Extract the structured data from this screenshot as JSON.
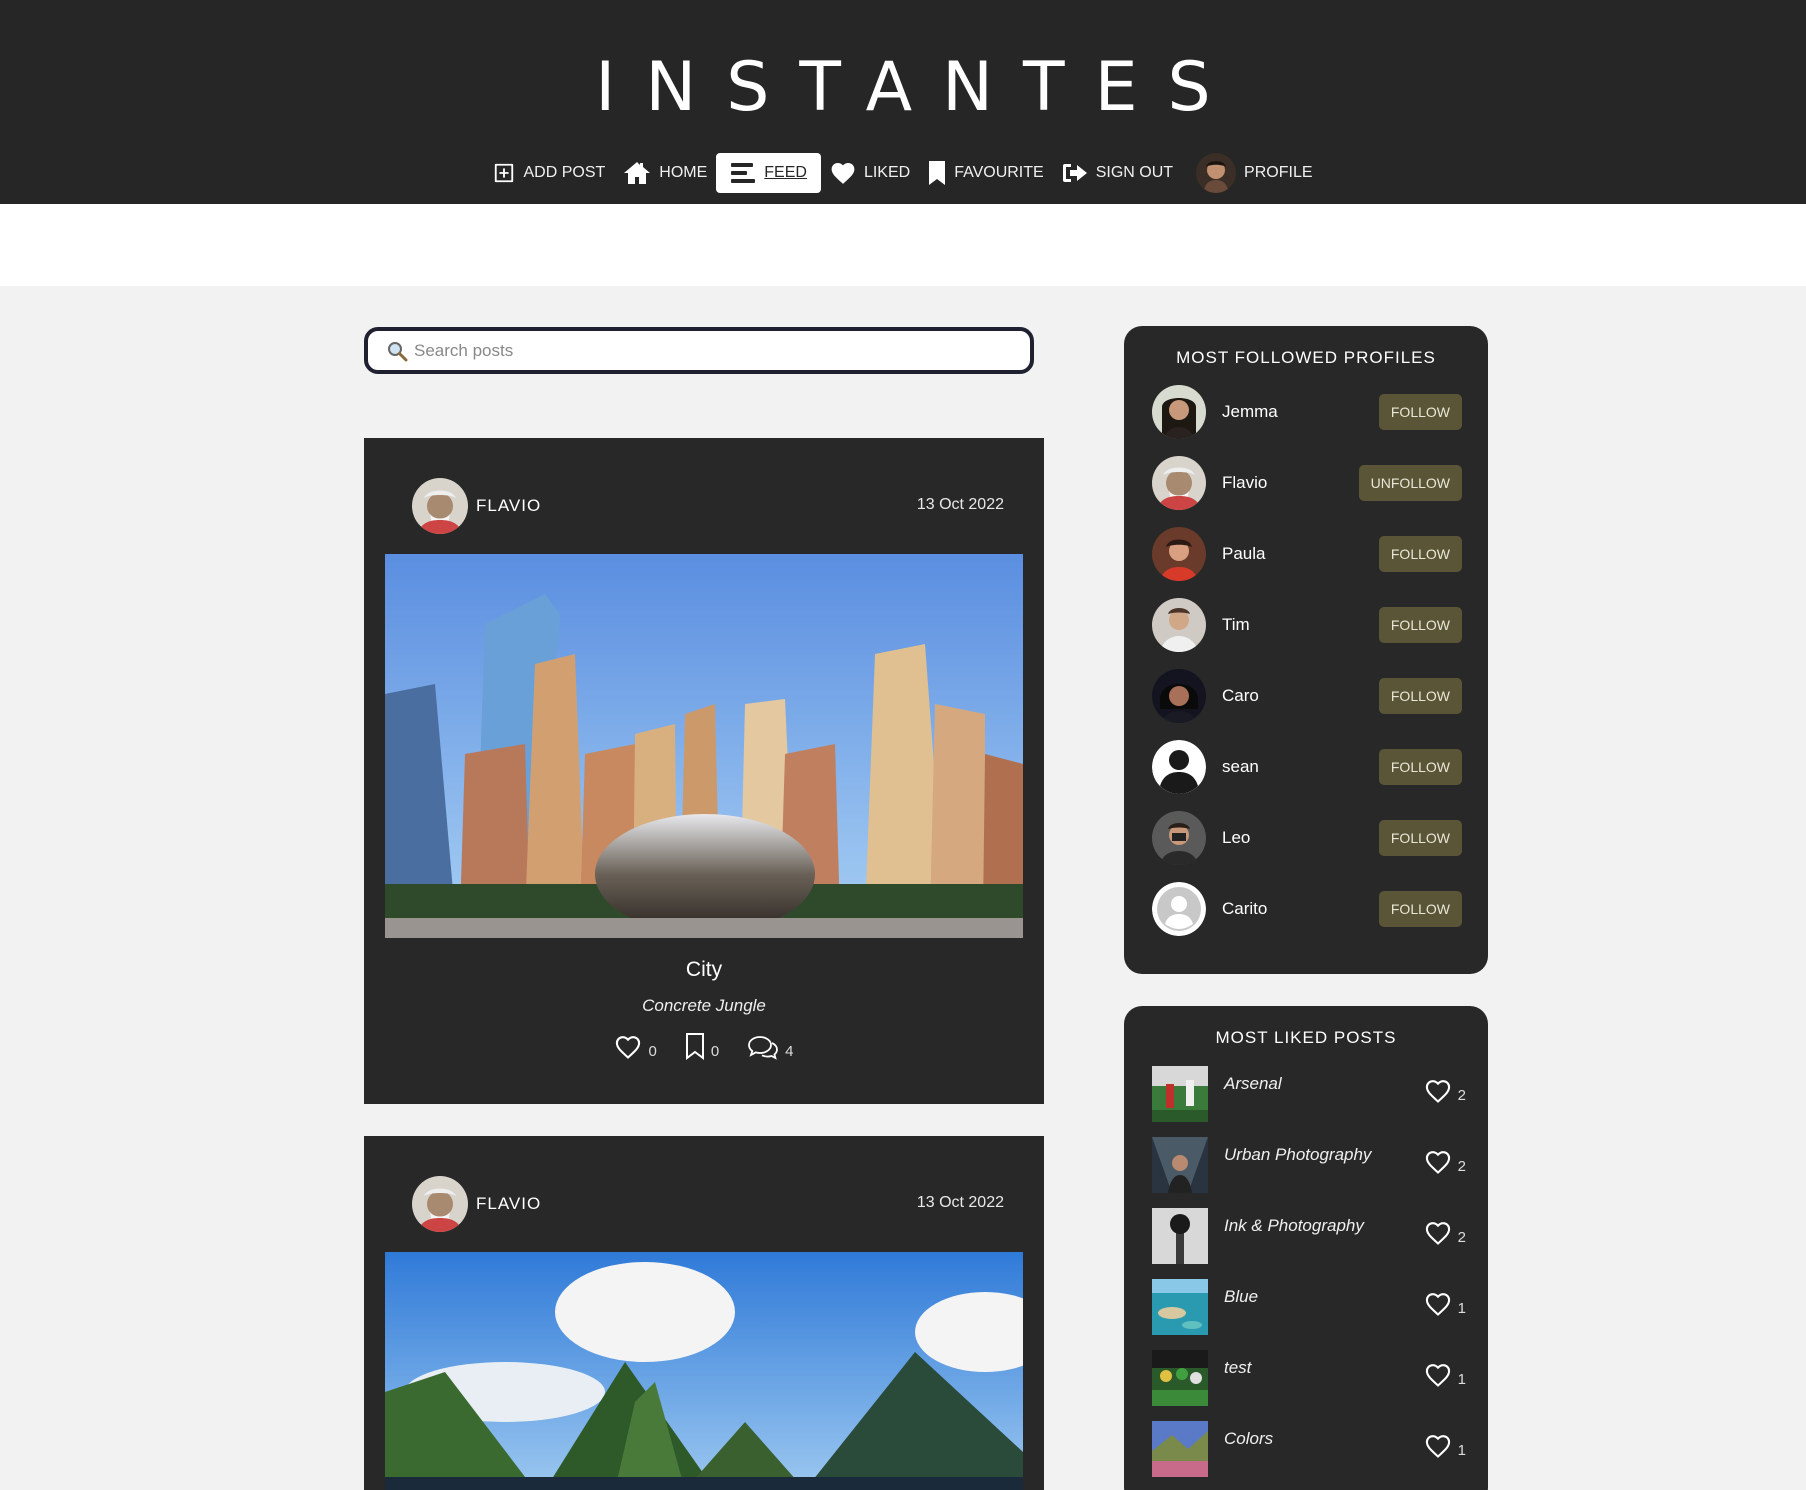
{
  "app": {
    "title": "INSTANTES"
  },
  "nav": {
    "items": [
      {
        "label": "ADD POST",
        "icon": "plus-square-icon"
      },
      {
        "label": "HOME",
        "icon": "home-icon"
      },
      {
        "label": "FEED",
        "icon": "feed-icon",
        "active": true
      },
      {
        "label": "LIKED",
        "icon": "heart-icon"
      },
      {
        "label": "FAVOURITE",
        "icon": "bookmark-icon"
      },
      {
        "label": "SIGN OUT",
        "icon": "sign-out-icon"
      },
      {
        "label": "PROFILE",
        "icon": "avatar"
      }
    ]
  },
  "search": {
    "placeholder": "Search posts"
  },
  "posts": [
    {
      "user": "FLAVIO",
      "date": "13 Oct 2022",
      "title": "City",
      "subtitle": "Concrete Jungle",
      "likes": "0",
      "favourites": "0",
      "comments": "4"
    },
    {
      "user": "FLAVIO",
      "date": "13 Oct 2022"
    }
  ],
  "most_followed": {
    "title": "MOST FOLLOWED PROFILES",
    "profiles": [
      {
        "name": "Jemma",
        "action": "FOLLOW"
      },
      {
        "name": "Flavio",
        "action": "UNFOLLOW"
      },
      {
        "name": "Paula",
        "action": "FOLLOW"
      },
      {
        "name": "Tim",
        "action": "FOLLOW"
      },
      {
        "name": "Caro",
        "action": "FOLLOW"
      },
      {
        "name": "sean",
        "action": "FOLLOW"
      },
      {
        "name": "Leo",
        "action": "FOLLOW"
      },
      {
        "name": "Carito",
        "action": "FOLLOW"
      }
    ]
  },
  "most_liked": {
    "title": "MOST LIKED POSTS",
    "posts": [
      {
        "title": "Arsenal",
        "likes": "2"
      },
      {
        "title": "Urban Photography",
        "likes": "2"
      },
      {
        "title": "Ink & Photography",
        "likes": "2"
      },
      {
        "title": "Blue",
        "likes": "1"
      },
      {
        "title": "test",
        "likes": "1"
      },
      {
        "title": "Colors",
        "likes": "1"
      }
    ]
  },
  "colors": {
    "header": "#262626",
    "card": "#282828",
    "button": "#5b5537",
    "background": "#f2f2f2"
  }
}
